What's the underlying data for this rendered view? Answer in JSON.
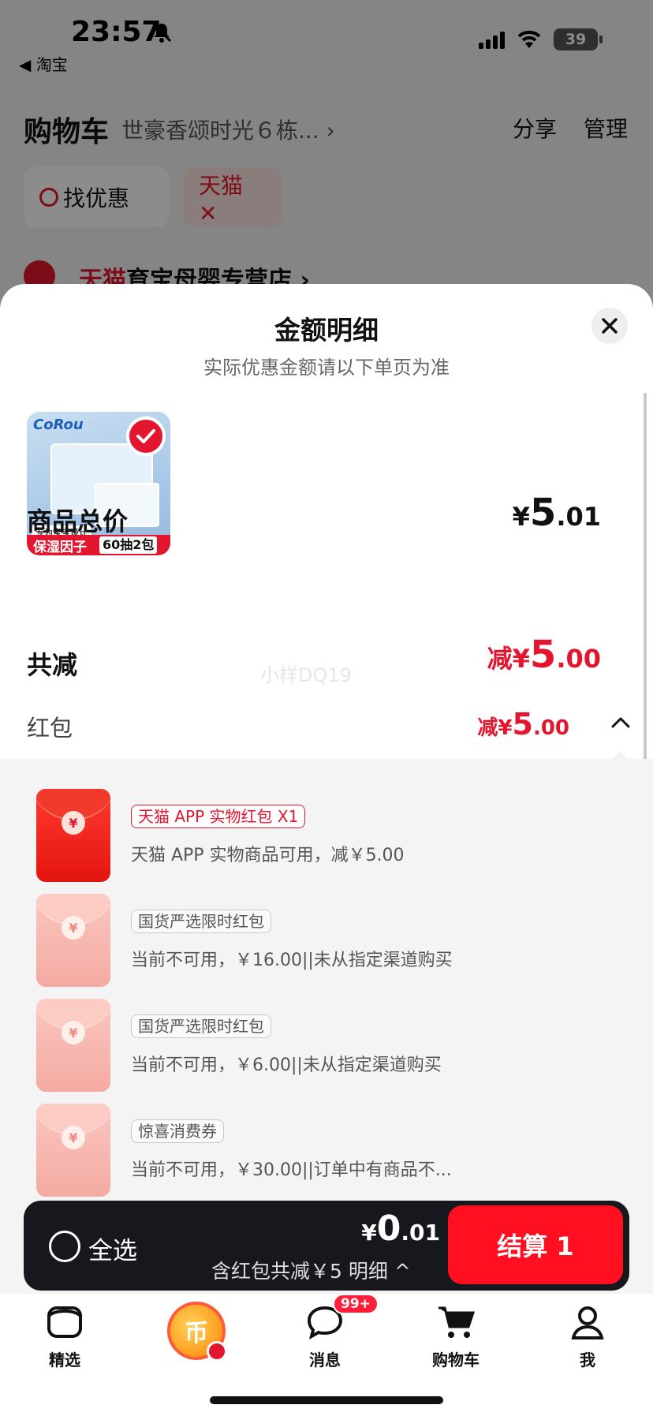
{
  "status_bar": {
    "time": "23:57",
    "back_app": "◀ 淘宝",
    "battery": "39"
  },
  "cart": {
    "title": "购物车",
    "address": "世豪香颂时光６栋... ›",
    "share": "分享",
    "manage": "管理",
    "chip_deals": "找优惠",
    "chip_tmall": "天猫 ✕",
    "shop_brand": "天猫",
    "shop_name": "育宝母婴专营店 ›"
  },
  "sheet": {
    "title": "金额明细",
    "subtitle": "实际优惠金额请以下单页为准",
    "product": {
      "brand": "CoRou",
      "tag": "专为宝宝设计",
      "band_left": "保湿因子",
      "band_right": "60抽2包"
    },
    "total_label": "商品总价",
    "total_currency": "¥",
    "total_int": "5",
    "total_dec": ".01",
    "discount_label": "共减",
    "discount_prefix": "减",
    "discount_currency": "¥",
    "discount_int": "5",
    "discount_dec": ".00",
    "watermark": "小样DQ19",
    "redpacket_label": "红包",
    "redpacket_prefix": "减",
    "redpacket_currency": "¥",
    "redpacket_int": "5",
    "redpacket_dec": ".00",
    "redpackets": [
      {
        "tag": "天猫 APP 实物红包 X1",
        "desc": "天猫 APP 实物商品可用，减￥5.00",
        "active": true
      },
      {
        "tag": "国货严选限时红包",
        "desc": "当前不可用，￥16.00||未从指定渠道购买",
        "active": false
      },
      {
        "tag": "国货严选限时红包",
        "desc": "当前不可用，￥6.00||未从指定渠道购买",
        "active": false
      },
      {
        "tag": "惊喜消费券",
        "desc": "当前不可用，￥30.00||订单中有商品不...",
        "active": false
      }
    ]
  },
  "checkout": {
    "select_all": "全选",
    "total_currency": "¥",
    "total_int": "0",
    "total_dec": ".01",
    "saving_text": "含红包共减￥5",
    "detail_link": "明细 ^",
    "settle_button": "结算 1"
  },
  "tabbar": {
    "items": [
      {
        "label": "精选",
        "icon": "home-icon"
      },
      {
        "label": "",
        "icon": "coin-icon"
      },
      {
        "label": "消息",
        "icon": "message-icon",
        "badge": "99+"
      },
      {
        "label": "购物车",
        "icon": "cart-icon"
      },
      {
        "label": "我",
        "icon": "profile-icon"
      }
    ]
  },
  "colors": {
    "accent": "#e4162f",
    "button": "#ff0f1f",
    "checkout_bar": "#17181e"
  }
}
